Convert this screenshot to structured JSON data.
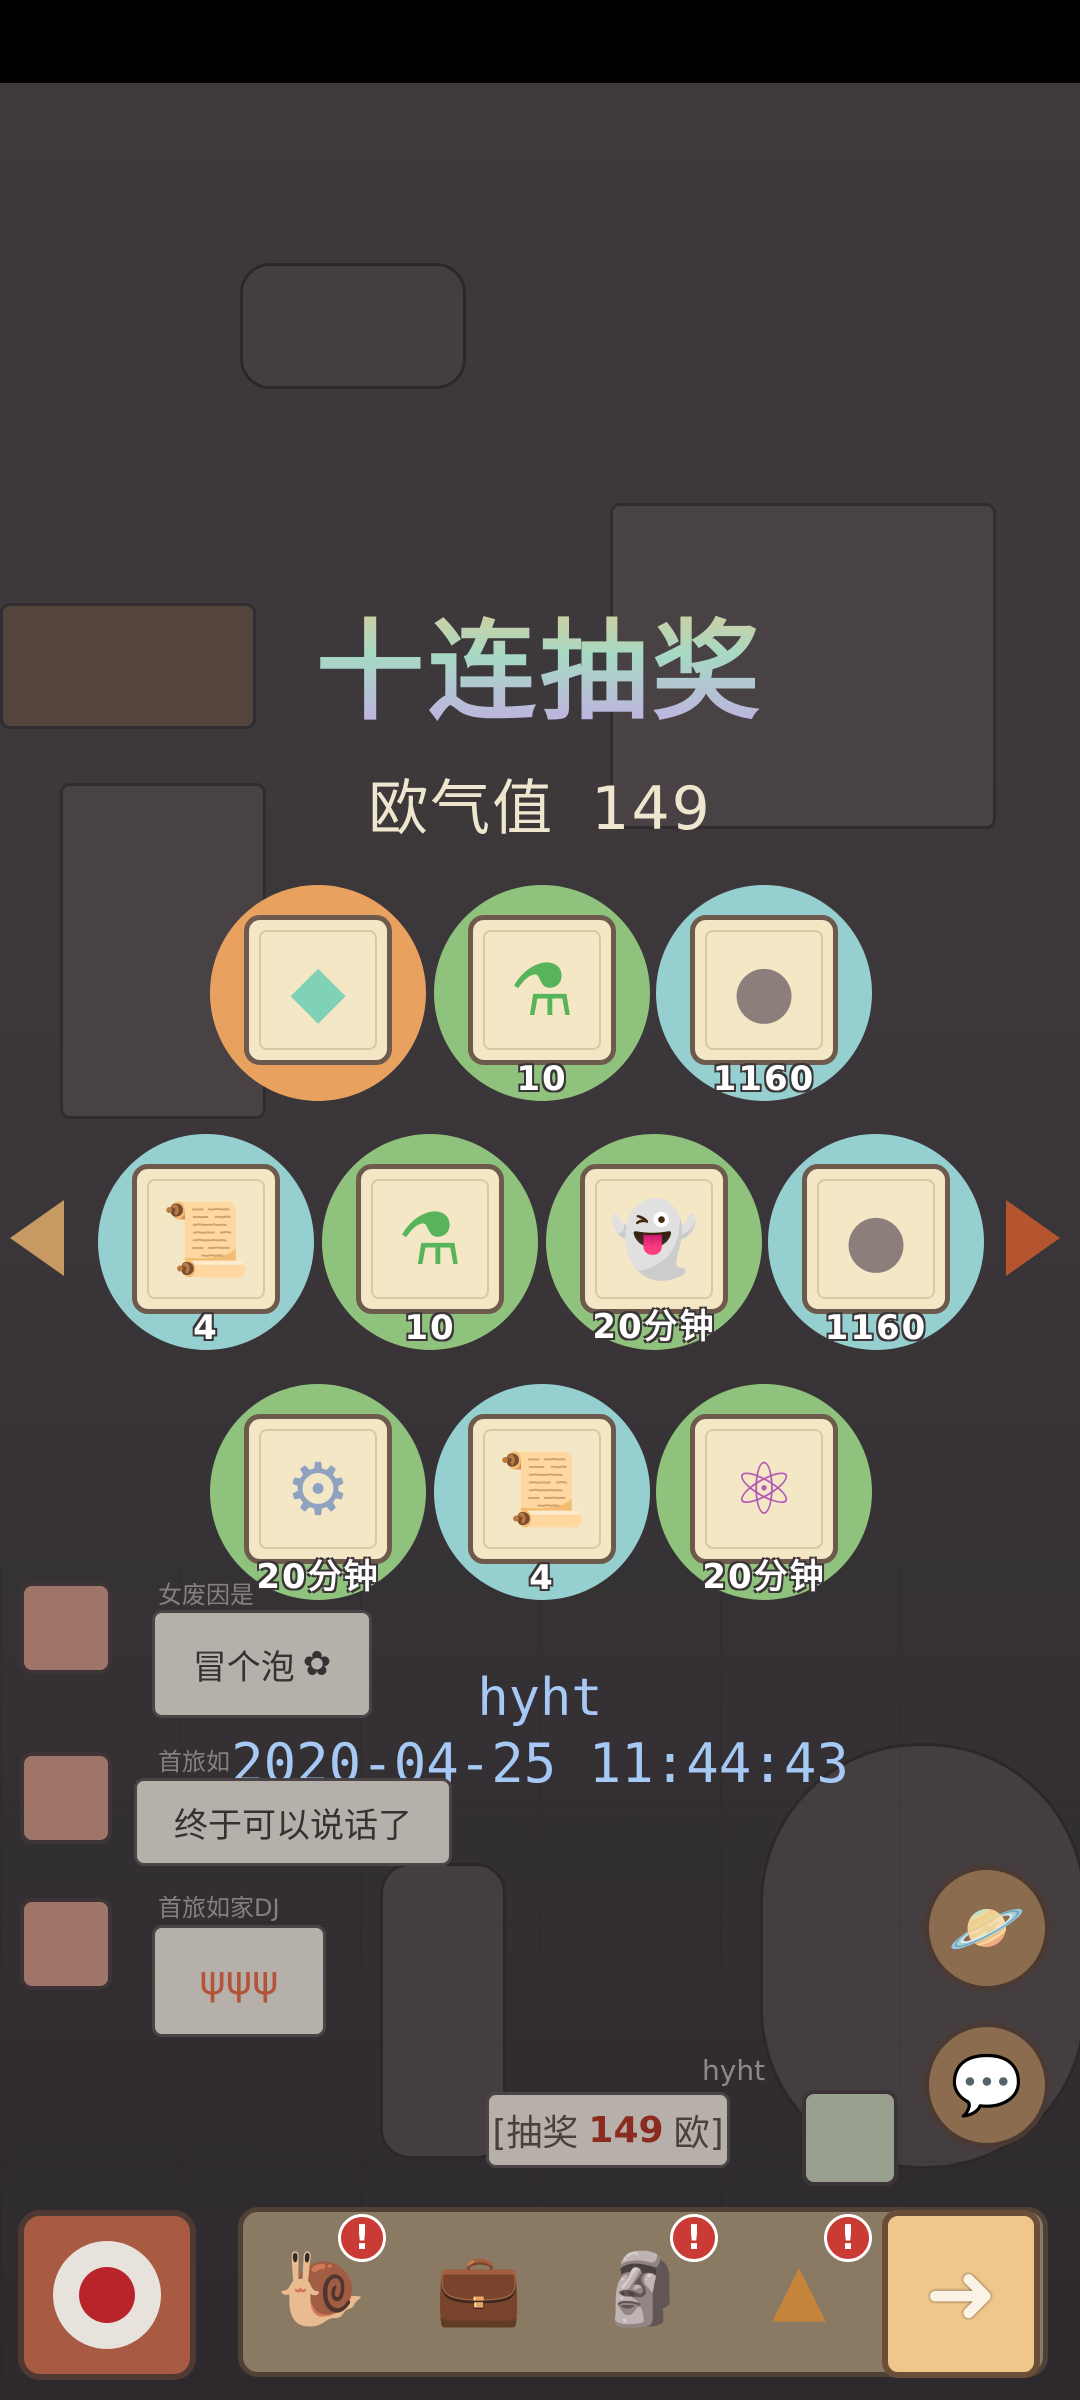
{
  "screen": {
    "title": "十连抽奖",
    "luck_label": "欧气值",
    "luck_value": "149"
  },
  "prizes": [
    {
      "icon": "crystal-icon",
      "qty": "",
      "bg": "#e9a160"
    },
    {
      "icon": "potion-bottle-icon",
      "qty": "10",
      "bg": "#8fc27d"
    },
    {
      "icon": "soul-blob-icon",
      "qty": "1160",
      "bg": "#96cfd0"
    },
    {
      "icon": "scroll-icon",
      "qty": "4",
      "bg": "#96cfd0"
    },
    {
      "icon": "potion-bottle-icon",
      "qty": "10",
      "bg": "#8fc27d"
    },
    {
      "icon": "ghost-icon",
      "qty": "20分钟",
      "bg": "#8fc27d"
    },
    {
      "icon": "soul-blob-icon",
      "qty": "1160",
      "bg": "#96cfd0"
    },
    {
      "icon": "gear-icon",
      "qty": "20分钟",
      "bg": "#8fc27d"
    },
    {
      "icon": "scroll-icon",
      "qty": "4",
      "bg": "#96cfd0"
    },
    {
      "icon": "molecule-icon",
      "qty": "20分钟",
      "bg": "#8fc27d"
    }
  ],
  "record": {
    "username": "hyht",
    "datetime": "2020-04-25 11:44:43"
  },
  "chat": [
    {
      "name": "女废因是",
      "text": "冒个泡"
    },
    {
      "name": "首旅如",
      "text": "终于可以说话了"
    },
    {
      "name": "首旅如家DJ",
      "text": ""
    }
  ],
  "lottery_message": {
    "username": "hyht",
    "prefix": "[抽奖",
    "amount": "149",
    "suffix": "欧]"
  },
  "toolbar": {
    "badge": "!"
  },
  "colors": {
    "orange": "#e9a160",
    "green": "#8fc27d",
    "blue": "#96cfd0",
    "stamp": "#a6c8f4"
  }
}
